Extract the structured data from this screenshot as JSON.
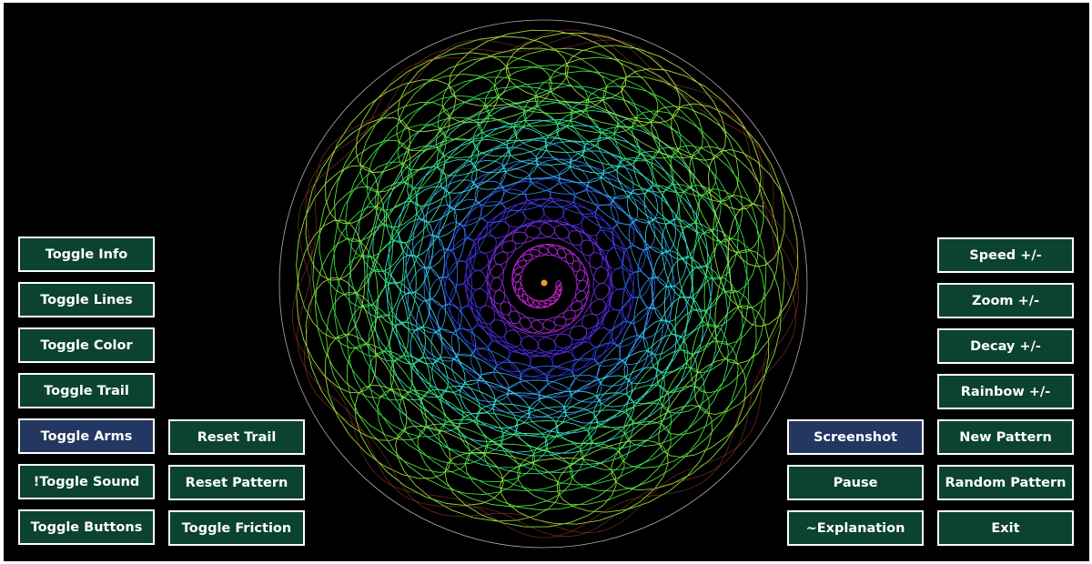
{
  "colors": {
    "background": "#000000",
    "button_fill": "#0b4232",
    "button_fill_active": "#243761",
    "button_border": "#ffffff",
    "button_text": "#ffffff",
    "boundary_circle": "#b0b0b0"
  },
  "left_buttons": [
    {
      "id": "toggle-info",
      "label": "Toggle Info",
      "active": false
    },
    {
      "id": "toggle-lines",
      "label": "Toggle Lines",
      "active": false
    },
    {
      "id": "toggle-color",
      "label": "Toggle Color",
      "active": false
    },
    {
      "id": "toggle-trail",
      "label": "Toggle Trail",
      "active": false
    },
    {
      "id": "toggle-arms",
      "label": "Toggle Arms",
      "active": true
    },
    {
      "id": "toggle-sound",
      "label": "!Toggle Sound",
      "active": false
    },
    {
      "id": "toggle-buttons",
      "label": "Toggle Buttons",
      "active": false
    }
  ],
  "left_inner_buttons": [
    {
      "id": "reset-trail",
      "label": "Reset Trail",
      "active": false
    },
    {
      "id": "reset-pattern",
      "label": "Reset Pattern",
      "active": false
    },
    {
      "id": "toggle-friction",
      "label": "Toggle Friction",
      "active": false
    }
  ],
  "right_inner_buttons": [
    {
      "id": "screenshot",
      "label": "Screenshot",
      "active": true
    },
    {
      "id": "pause",
      "label": "Pause",
      "active": false
    },
    {
      "id": "explanation",
      "label": "~Explanation",
      "active": false
    }
  ],
  "right_buttons": [
    {
      "id": "speed",
      "label": "Speed +/-",
      "active": false
    },
    {
      "id": "zoom",
      "label": "Zoom +/-",
      "active": false
    },
    {
      "id": "decay",
      "label": "Decay +/-",
      "active": false
    },
    {
      "id": "rainbow",
      "label": "Rainbow +/-",
      "active": false
    },
    {
      "id": "new-pattern",
      "label": "New Pattern",
      "active": false
    },
    {
      "id": "random-pattern",
      "label": "Random Pattern",
      "active": false
    },
    {
      "id": "exit",
      "label": "Exit",
      "active": false
    }
  ]
}
